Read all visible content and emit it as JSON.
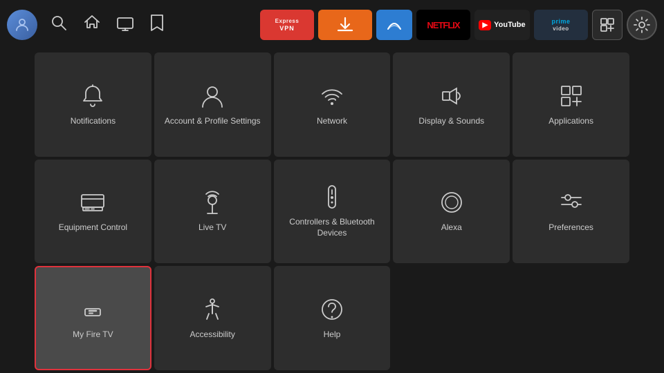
{
  "nav": {
    "apps": [
      {
        "id": "expressvpn",
        "label": "ExpressVPN",
        "type": "expressvpn"
      },
      {
        "id": "downloader",
        "label": "Downloader",
        "type": "downloader"
      },
      {
        "id": "generic",
        "label": "↑",
        "type": "generic"
      },
      {
        "id": "netflix",
        "label": "NETFLIX",
        "type": "netflix"
      },
      {
        "id": "youtube",
        "label": "YouTube",
        "type": "youtube"
      },
      {
        "id": "prime",
        "label": "prime video",
        "type": "prime"
      },
      {
        "id": "appgrid",
        "label": "⊞",
        "type": "grid"
      }
    ]
  },
  "grid": {
    "items": [
      {
        "id": "notifications",
        "label": "Notifications",
        "icon": "bell"
      },
      {
        "id": "account",
        "label": "Account & Profile Settings",
        "icon": "person"
      },
      {
        "id": "network",
        "label": "Network",
        "icon": "wifi"
      },
      {
        "id": "display",
        "label": "Display & Sounds",
        "icon": "speaker"
      },
      {
        "id": "applications",
        "label": "Applications",
        "icon": "apps"
      },
      {
        "id": "equipment",
        "label": "Equipment Control",
        "icon": "tv"
      },
      {
        "id": "livetv",
        "label": "Live TV",
        "icon": "antenna"
      },
      {
        "id": "controllers",
        "label": "Controllers & Bluetooth Devices",
        "icon": "remote"
      },
      {
        "id": "alexa",
        "label": "Alexa",
        "icon": "alexa"
      },
      {
        "id": "preferences",
        "label": "Preferences",
        "icon": "sliders"
      },
      {
        "id": "myfiretv",
        "label": "My Fire TV",
        "icon": "firetv",
        "selected": true
      },
      {
        "id": "accessibility",
        "label": "Accessibility",
        "icon": "accessibility"
      },
      {
        "id": "help",
        "label": "Help",
        "icon": "help"
      }
    ]
  }
}
